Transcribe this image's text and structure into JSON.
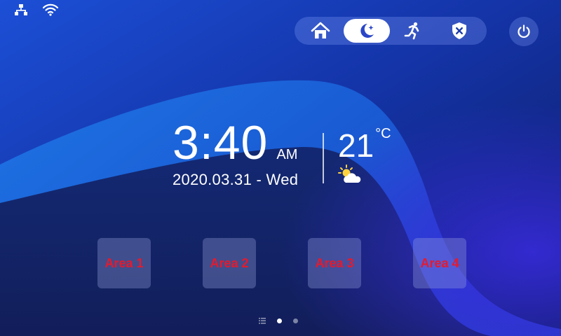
{
  "status_bar": {
    "network_icon": "network-icon",
    "wifi_icon": "wifi-icon"
  },
  "mode_bar": {
    "modes": [
      {
        "icon": "home-icon",
        "active": false
      },
      {
        "icon": "moon-icon",
        "active": true
      },
      {
        "icon": "running-person-icon",
        "active": false
      },
      {
        "icon": "shield-x-icon",
        "active": false
      }
    ]
  },
  "power_button": {
    "icon": "power-icon"
  },
  "clock": {
    "time": "3:40",
    "ampm": "AM",
    "date": "2020.03.31 - Wed"
  },
  "weather": {
    "temperature": "21",
    "unit": "°C",
    "icon": "partly-cloudy-icon"
  },
  "areas": [
    {
      "label": "Area 1"
    },
    {
      "label": "Area 2"
    },
    {
      "label": "Area 3"
    },
    {
      "label": "Area 4"
    }
  ],
  "pager": {
    "pages": 3,
    "active_index": 1
  },
  "colors": {
    "area_label": "#e8192b",
    "background_dark": "#0e1f78",
    "background_accent": "#1a78e6"
  }
}
